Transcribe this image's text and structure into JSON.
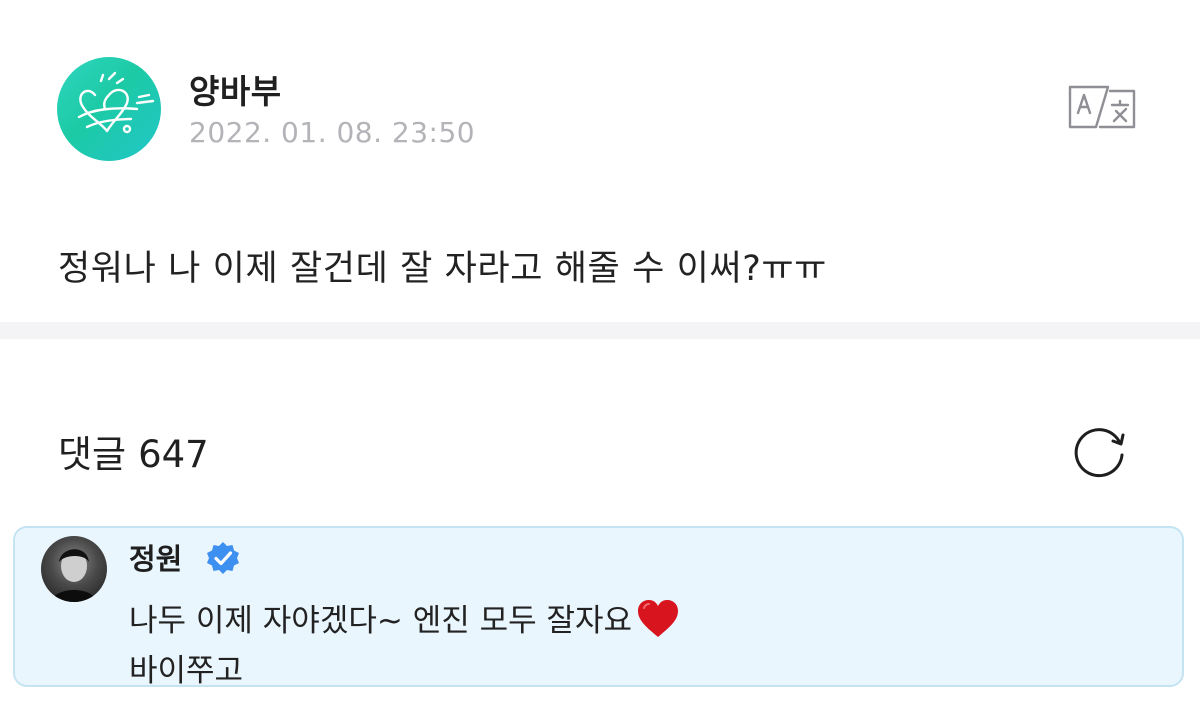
{
  "post": {
    "author": {
      "name": "양바부",
      "avatar_icon": "heart-doodle-avatar"
    },
    "timestamp": "2022. 01. 08. 23:50",
    "translate_icon": "translate-icon",
    "body": "정워나 나 이제 잘건데 잘 자라고 해줄 수 이써?ㅠㅠ"
  },
  "comments": {
    "label": "댓글",
    "count": "647",
    "refresh_icon": "refresh-icon",
    "highlighted": {
      "author": "정원",
      "verified_icon": "verified-badge-icon",
      "line1": "나두 이제 자야겠다~ 엔진 모두 잘자요",
      "line1_emoji": "red-heart-icon",
      "line2": "바이쭈고"
    }
  },
  "colors": {
    "avatar_teal": "#22cdb3",
    "timestamp_gray": "#b3b3b8",
    "divider": "#f4f4f7",
    "comment_bg": "#eaf6fd",
    "comment_border": "#c5e4f3",
    "verified_blue": "#3d8ff0",
    "heart_red": "#d8141f"
  }
}
